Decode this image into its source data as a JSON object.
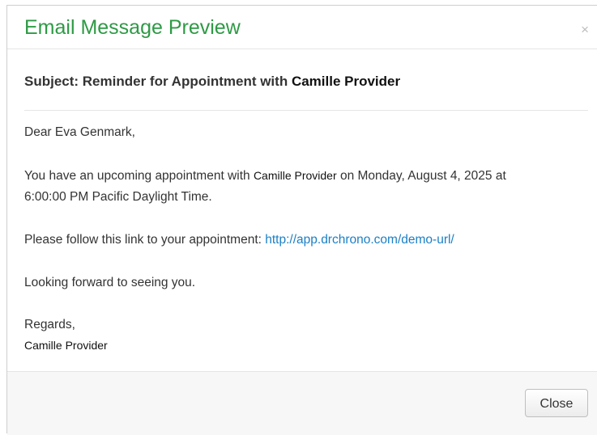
{
  "modal": {
    "title": "Email Message Preview",
    "close_glyph": "×",
    "title_color": "#2e9a45",
    "link_color": "#1a7fc6"
  },
  "email": {
    "subject_prefix": "Subject: Reminder for Appointment with",
    "subject_provider": "Camille Provider",
    "greeting": "Dear Eva Genmark,",
    "appointment_prefix": "You have an upcoming appointment with",
    "appointment_provider": "Camille Provider",
    "appointment_suffix": "on Monday, August 4, 2025 at",
    "appointment_time": "6:00:00 PM Pacific Daylight Time.",
    "link_prefix": "Please follow this link to your appointment:",
    "link_url": "http://app.drchrono.com/demo-url/",
    "closing": "Looking forward to seeing you.",
    "regards": "Regards,",
    "signature": "Camille Provider"
  },
  "footer": {
    "close_label": "Close"
  }
}
